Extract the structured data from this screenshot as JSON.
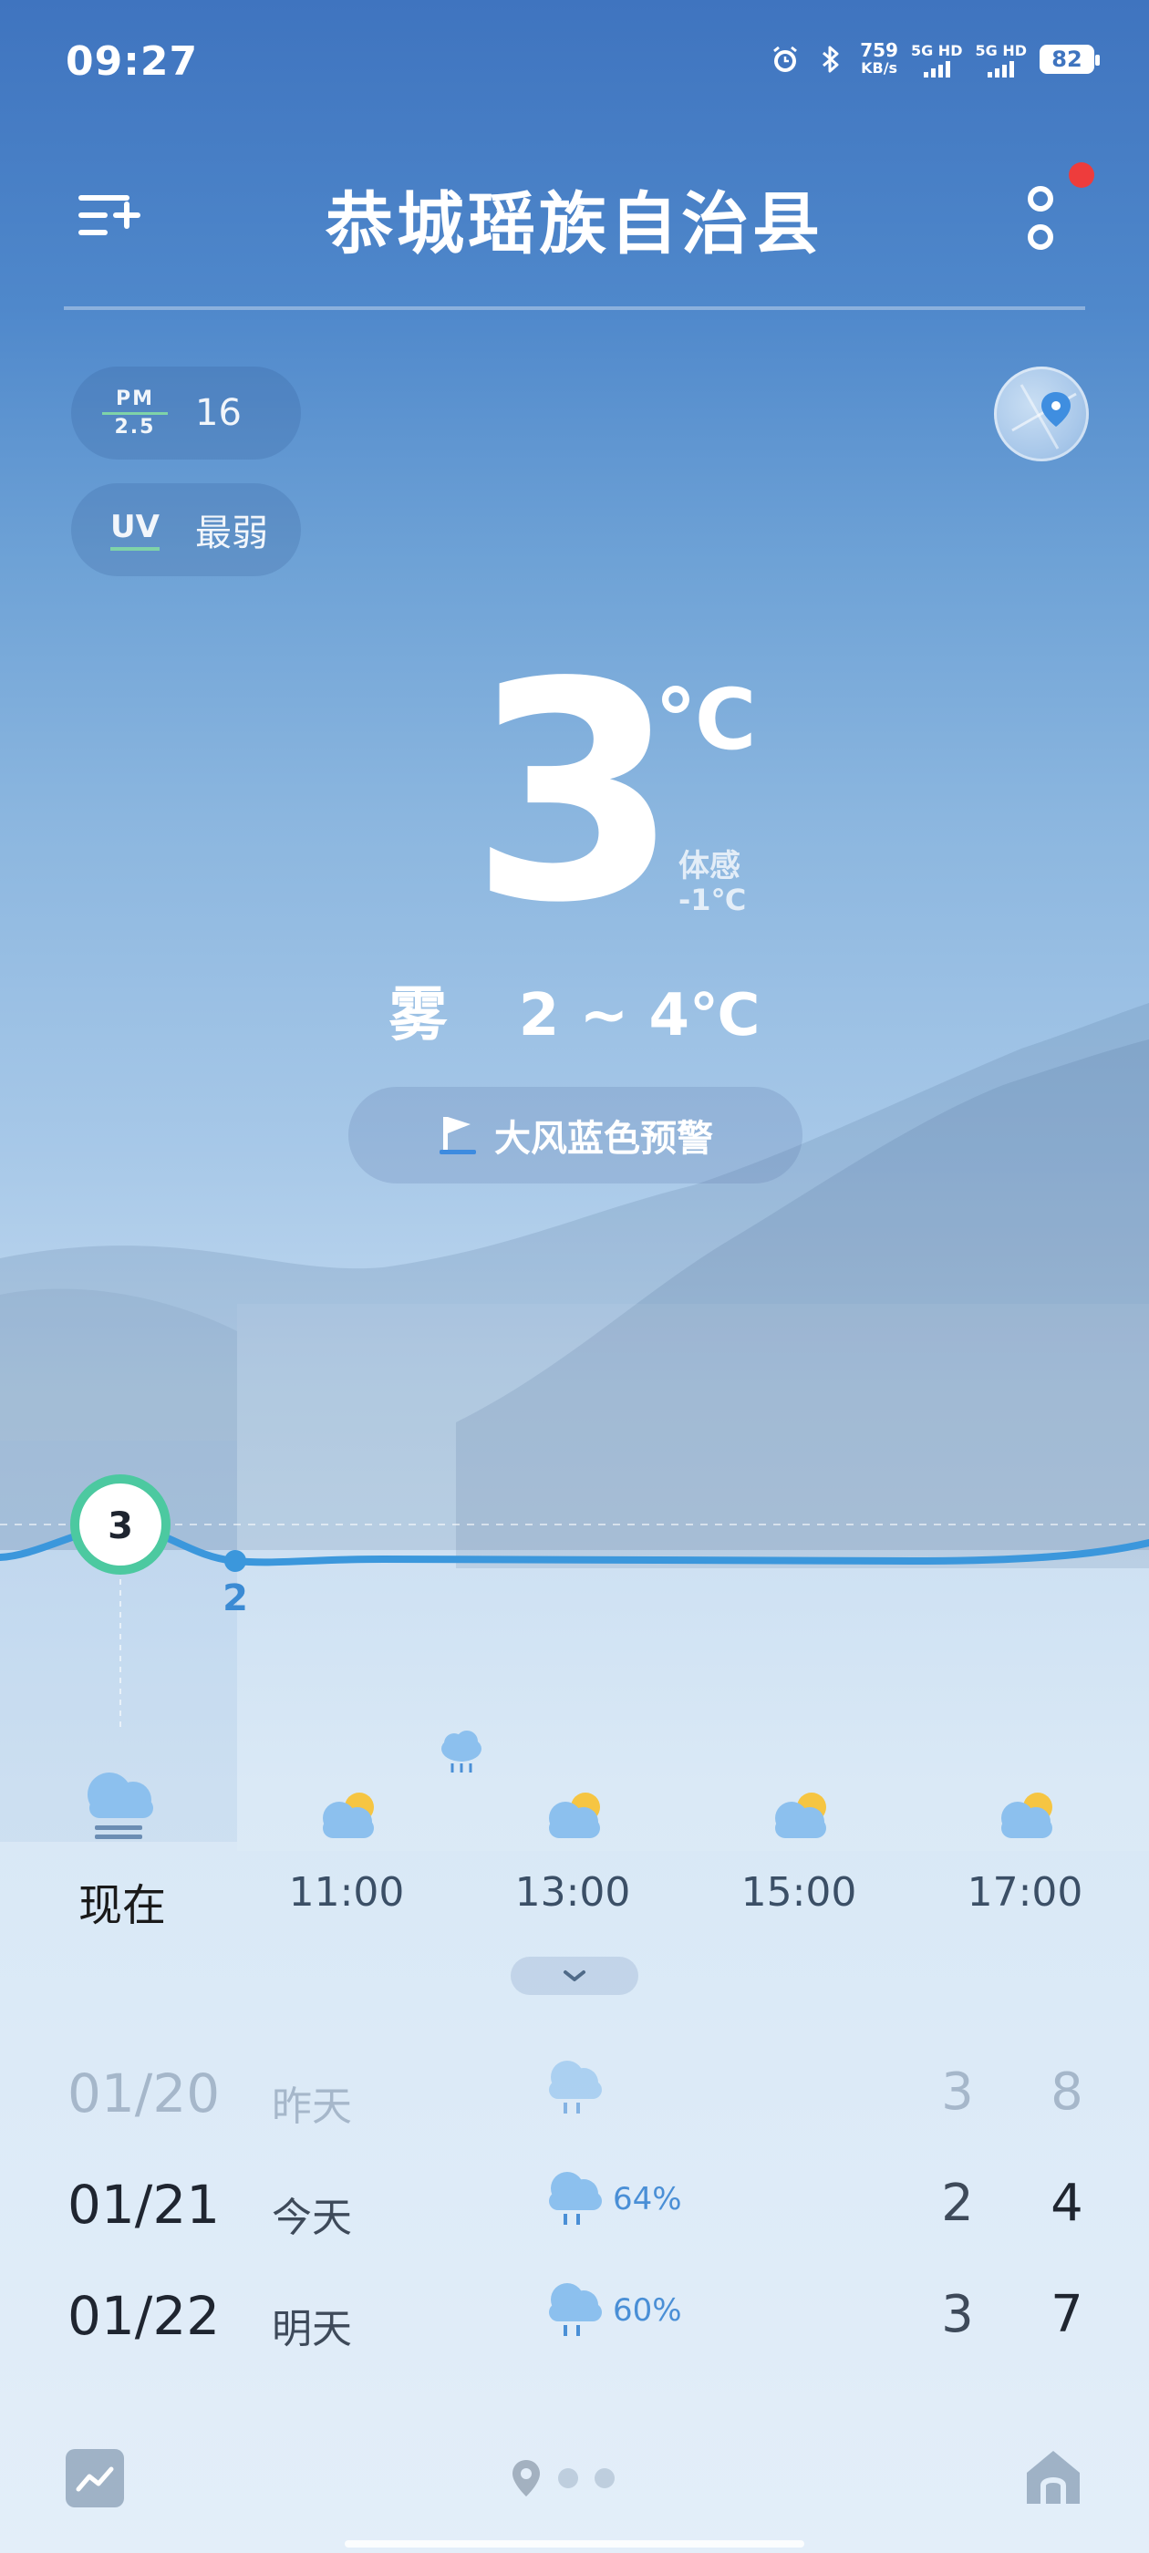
{
  "status_bar": {
    "time": "09:27",
    "net_speed_value": "759",
    "net_speed_unit": "KB/s",
    "sim1": "5G HD",
    "sim2": "5G HD",
    "battery": "82"
  },
  "header": {
    "city": "恭城瑶族自治县"
  },
  "air": {
    "pm_label_top": "PM",
    "pm_label_bottom": "2.5",
    "pm_value": "16",
    "uv_label": "UV",
    "uv_value": "最弱"
  },
  "current": {
    "temp": "3",
    "unit": "℃",
    "feels_label": "体感",
    "feels_value": "-1℃",
    "condition": "雾",
    "range": "2 ~ 4℃",
    "alert": "大风蓝色预警"
  },
  "hourly": {
    "point_labels": [
      "3",
      "2"
    ],
    "hours": [
      "现在",
      "11:00",
      "13:00",
      "15:00",
      "17:00"
    ],
    "icons": [
      "fog-cloud",
      "partly-cloudy",
      "partly-cloudy",
      "partly-cloudy",
      "partly-cloudy"
    ]
  },
  "daily": [
    {
      "date": "01/20",
      "name": "昨天",
      "icon": "rain-cloud",
      "pop": "",
      "low": "3",
      "high": "8"
    },
    {
      "date": "01/21",
      "name": "今天",
      "icon": "rain-cloud",
      "pop": "64%",
      "low": "2",
      "high": "4"
    },
    {
      "date": "01/22",
      "name": "明天",
      "icon": "rain-cloud",
      "pop": "60%",
      "low": "3",
      "high": "7"
    }
  ],
  "colors": {
    "accent_green": "#4cc9a0",
    "curve_blue": "#3b97dc",
    "alert_red": "#ee3c3c"
  }
}
